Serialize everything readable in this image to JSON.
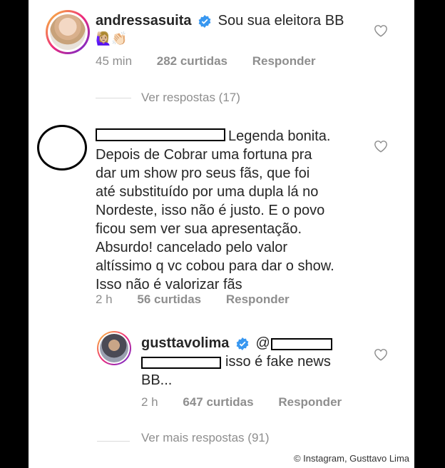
{
  "comments": [
    {
      "username": "andressasuita",
      "text": "Sou sua eleitora BB",
      "emojis": "🙋🏼‍♀️👏🏻",
      "time": "45 min",
      "likes": "282 curtidas",
      "reply_label": "Responder"
    },
    {
      "text_lines": [
        "Legenda bonita.",
        "Depois de Cobrar uma fortuna pra",
        "dar um show pro seus fãs, que foi",
        "até substituído por uma dupla lá no",
        "Nordeste, isso não é justo.  E o povo",
        "ficou sem ver sua apresentação.",
        "Absurdo! cancelado pelo valor",
        "altíssimo q vc cobou para dar o show.",
        "Isso não é valorizar fãs"
      ],
      "time": "2 h",
      "likes": "56 curtidas",
      "reply_label": "Responder"
    }
  ],
  "view_replies_1": "Ver respostas (17)",
  "reply": {
    "username": "gusttavolima",
    "mention": "@",
    "text": "isso é fake news",
    "text2": "BB...",
    "time": "2 h",
    "likes": "647 curtidas",
    "reply_label": "Responder"
  },
  "view_more_replies": "Ver mais respostas (91)",
  "credit": "© Instagram, Gusttavo Lima",
  "colors": {
    "verified": "#3897f0",
    "text": "#262626",
    "meta": "#8e8e8e"
  }
}
